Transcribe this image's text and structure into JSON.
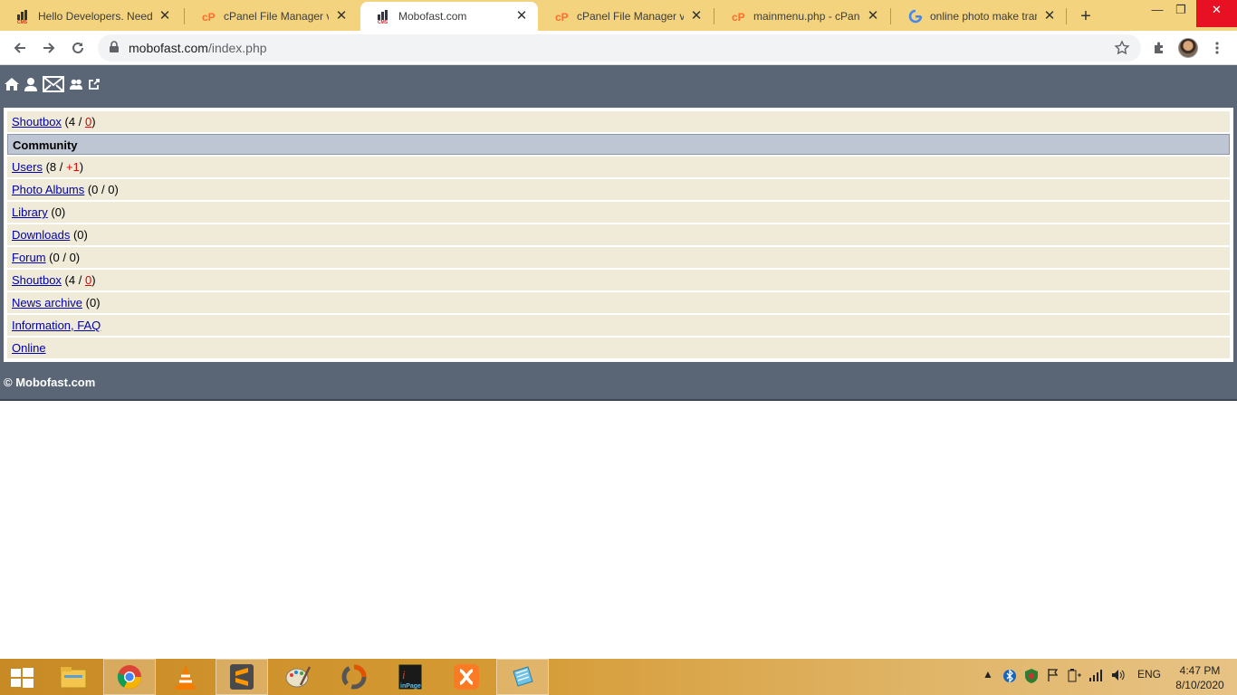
{
  "browser": {
    "tabs": [
      {
        "title": "Hello Developers. Need S",
        "favicon": "cms-favicon"
      },
      {
        "title": "cPanel File Manager v3",
        "favicon": "cpanel-favicon"
      },
      {
        "title": "Mobofast.com",
        "favicon": "cms-favicon",
        "active": true
      },
      {
        "title": "cPanel File Manager v3",
        "favicon": "cpanel-favicon"
      },
      {
        "title": "mainmenu.php - cPanel",
        "favicon": "cpanel-favicon"
      },
      {
        "title": "online photo make trans",
        "favicon": "google-favicon"
      }
    ],
    "url_domain": "mobofast.com",
    "url_path": "/index.php"
  },
  "header_icons": [
    "home-icon",
    "user-icon",
    "mail-icon",
    "users-icon",
    "logout-icon"
  ],
  "rows": {
    "shoutbox_top": {
      "label": "Shoutbox",
      "pre": " (4 / ",
      "count": "0",
      "post": ")"
    },
    "community": {
      "label": "Community"
    },
    "users": {
      "label": "Users",
      "pre": " (8 / ",
      "count": "+1",
      "post": ")"
    },
    "photo_albums": {
      "label": "Photo Albums",
      "suffix": " (0 / 0)"
    },
    "library": {
      "label": "Library",
      "suffix": " (0)"
    },
    "downloads": {
      "label": "Downloads",
      "suffix": " (0)"
    },
    "forum": {
      "label": "Forum",
      "suffix": " (0 / 0)"
    },
    "shoutbox": {
      "label": "Shoutbox",
      "pre": " (4 / ",
      "count": "0",
      "post": ")"
    },
    "news_archive": {
      "label": "News archive",
      "suffix": " (0)"
    },
    "information": {
      "label": "Information, FAQ"
    },
    "online": {
      "label": "Online"
    }
  },
  "footer": {
    "copyright": "© Mobofast.com"
  },
  "taskbar": {
    "language": "ENG",
    "time": "4:47 PM",
    "date": "8/10/2020"
  },
  "colors": {
    "tab_strip": "#f3d37d",
    "site_bar": "#5a6676",
    "row_bg": "#efebd8",
    "heading_bg": "#bec5d3",
    "link": "#0000aa",
    "count_red": "#dd0000"
  }
}
